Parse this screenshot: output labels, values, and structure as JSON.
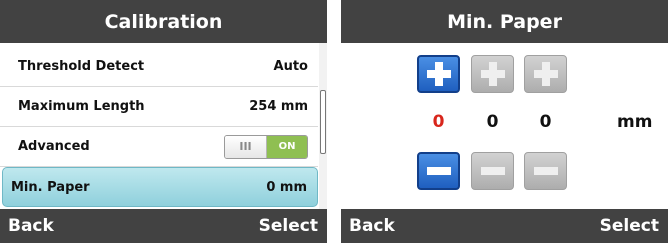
{
  "left": {
    "title": "Calibration",
    "items": [
      {
        "label": "Threshold Detect",
        "value": "Auto"
      },
      {
        "label": "Maximum Length",
        "value": "254 mm"
      },
      {
        "label": "Advanced",
        "toggle": {
          "knob": "III",
          "state": "ON"
        }
      },
      {
        "label": "Min. Paper",
        "value": "0 mm"
      }
    ],
    "softkeys": {
      "left": "Back",
      "right": "Select"
    }
  },
  "right": {
    "title": "Min. Paper",
    "digits": [
      "0",
      "0",
      "0"
    ],
    "unit": "mm",
    "softkeys": {
      "left": "Back",
      "right": "Select"
    }
  },
  "colors": {
    "bar": "#424242",
    "selected_row": "#8fd0dc",
    "active_digit": "#d8261c",
    "toggle_on": "#8fbf52",
    "step_active": "#1f5fbf",
    "step_inactive": "#adadad"
  },
  "icons": {
    "increment": "plus-icon",
    "decrement": "minus-icon"
  }
}
